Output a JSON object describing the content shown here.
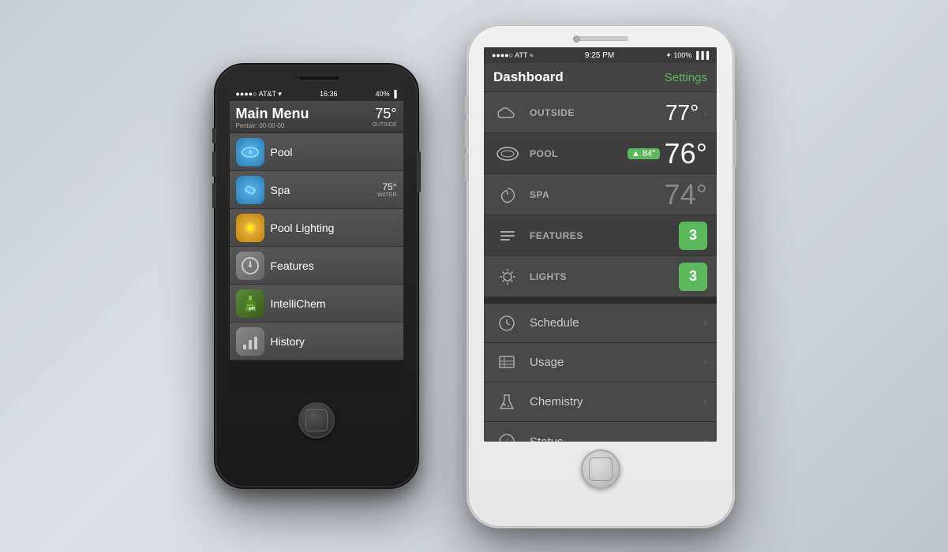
{
  "left_phone": {
    "status_bar": {
      "signal": "●●●●○ AT&T ▾",
      "time": "16:36",
      "battery": "40% ▐"
    },
    "header": {
      "title": "Main Menu",
      "temp": "75°",
      "subtitle": "Pentair: 00-00-00",
      "outside_label": "OUTSIDE"
    },
    "menu_items": [
      {
        "id": "pool",
        "label": "Pool",
        "icon_type": "pool",
        "badge": ""
      },
      {
        "id": "spa",
        "label": "Spa",
        "icon_type": "spa",
        "badge": "75°\nWATER"
      },
      {
        "id": "pool-lighting",
        "label": "Pool Lighting",
        "icon_type": "lighting",
        "badge": ""
      },
      {
        "id": "features",
        "label": "Features",
        "icon_type": "features",
        "badge": ""
      },
      {
        "id": "intellichem",
        "label": "IntelliChem",
        "icon_type": "intellichem",
        "badge": ""
      },
      {
        "id": "history",
        "label": "History",
        "icon_type": "history",
        "badge": ""
      }
    ]
  },
  "right_phone": {
    "status_bar": {
      "signal": "●●●●○ ATT",
      "wifi": "▾",
      "time": "9:25 PM",
      "bluetooth": "✦",
      "battery": "100%"
    },
    "header": {
      "title": "Dashboard",
      "settings_label": "Settings"
    },
    "temp_rows": [
      {
        "id": "outside",
        "label": "OUTSIDE",
        "icon": "cloud",
        "temp": "77°",
        "has_chevron": true,
        "badge": null,
        "badge_text": ""
      },
      {
        "id": "pool",
        "label": "POOL",
        "icon": "pool-oval",
        "temp": "76°",
        "has_chevron": false,
        "badge": "▲ 84°",
        "badge_text": "▲ 84°"
      },
      {
        "id": "spa",
        "label": "SPA",
        "icon": "spa-swirl",
        "temp": "74°",
        "has_chevron": false,
        "badge": null,
        "badge_text": ""
      }
    ],
    "feature_rows": [
      {
        "id": "features",
        "label": "FEATURES",
        "icon": "features-bars",
        "count": "3"
      },
      {
        "id": "lights",
        "label": "LIGHTS",
        "icon": "sun",
        "count": "3"
      }
    ],
    "list_rows": [
      {
        "id": "schedule",
        "label": "Schedule",
        "icon": "clock"
      },
      {
        "id": "usage",
        "label": "Usage",
        "icon": "chart"
      },
      {
        "id": "chemistry",
        "label": "Chemistry",
        "icon": "chemistry"
      },
      {
        "id": "status",
        "label": "Status",
        "icon": "info"
      }
    ]
  }
}
